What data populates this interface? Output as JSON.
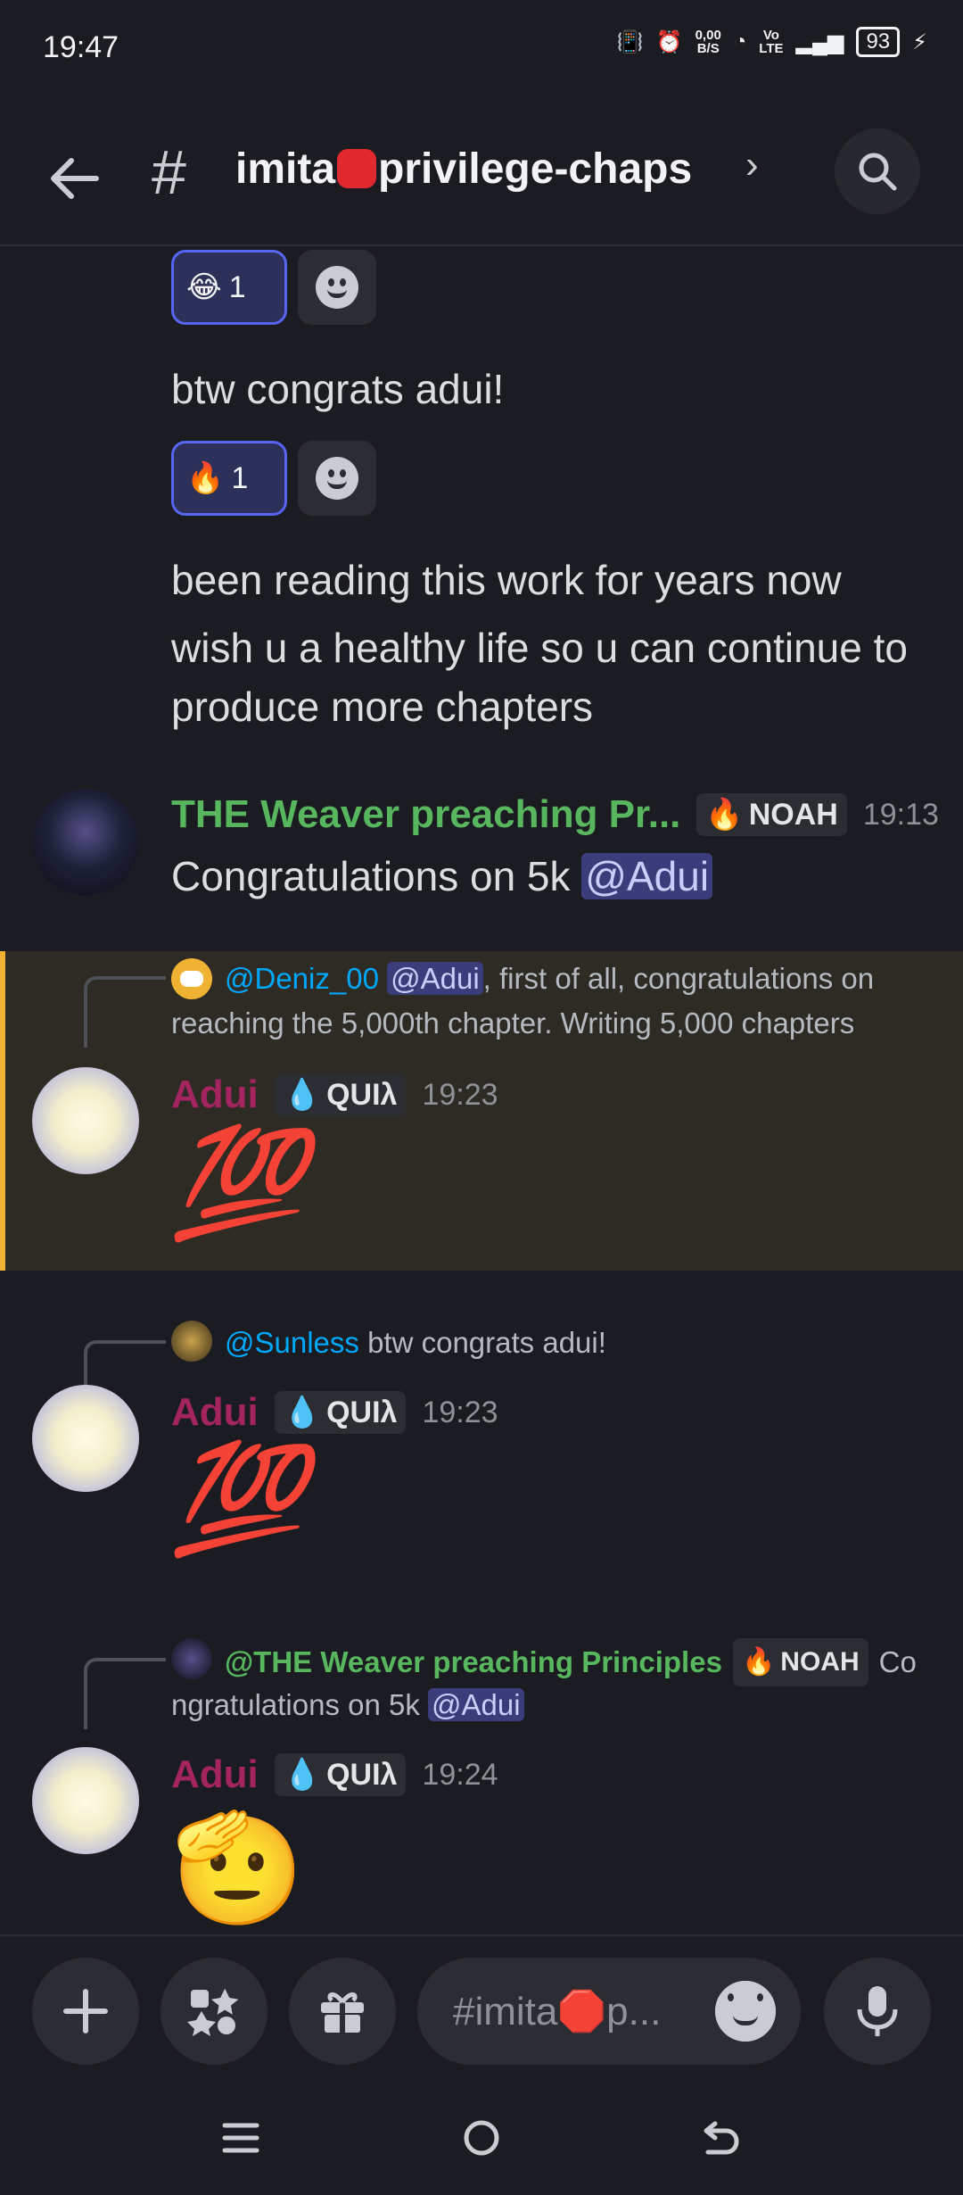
{
  "status_bar": {
    "time": "19:47",
    "net_speed_top": "0,00",
    "net_speed_bottom": "B/S",
    "volte_top": "Vo",
    "volte_bottom": "LTE",
    "battery": "93"
  },
  "header": {
    "channel_prefix": "imita",
    "channel_suffix": "privilege-chaps"
  },
  "messages": {
    "top_reaction_1": {
      "emoji": "😂",
      "count": "1"
    },
    "text_1": "btw congrats adui!",
    "top_reaction_2": {
      "emoji": "🔥",
      "count": "1"
    },
    "text_2": "been reading this work for years now",
    "text_3_line1": "wish u a healthy life so u can continue to",
    "text_3_line2": "produce more chapters",
    "weaver": {
      "username": "THE Weaver preaching Pr...",
      "tag": "NOAH",
      "time": "19:13",
      "text": "Congratulations on 5k ",
      "mention": "@Adui"
    },
    "reply1": {
      "mention_user": "@Deniz_00",
      "mention": "@Adui",
      "line1_rest": ", first of all, congratulations on",
      "line2": "reaching the 5,000th chapter. Writing 5,000 chapters",
      "username": "Adui",
      "tag": "QUIλ",
      "time": "19:23",
      "content": "💯"
    },
    "reply2": {
      "mention_user": "@Sunless",
      "text": " btw congrats adui!",
      "username": "Adui",
      "tag": "QUIλ",
      "time": "19:23",
      "content": "💯"
    },
    "reply3": {
      "mention_user": "@THE Weaver preaching Principles",
      "tag_ref": "NOAH",
      "line1_end": " Co",
      "line2": "ngratulations on 5k ",
      "mention": "@Adui",
      "username": "Adui",
      "tag": "QUIλ",
      "time": "19:24",
      "content": "🫡"
    }
  },
  "composer": {
    "placeholder": "#imita🛑p..."
  },
  "icons": [
    "back-arrow-icon",
    "hash-icon",
    "search-icon",
    "smile-icon",
    "plus-icon",
    "apps-icon",
    "gift-icon",
    "mic-icon",
    "menu-icon",
    "home-icon",
    "back-icon"
  ]
}
